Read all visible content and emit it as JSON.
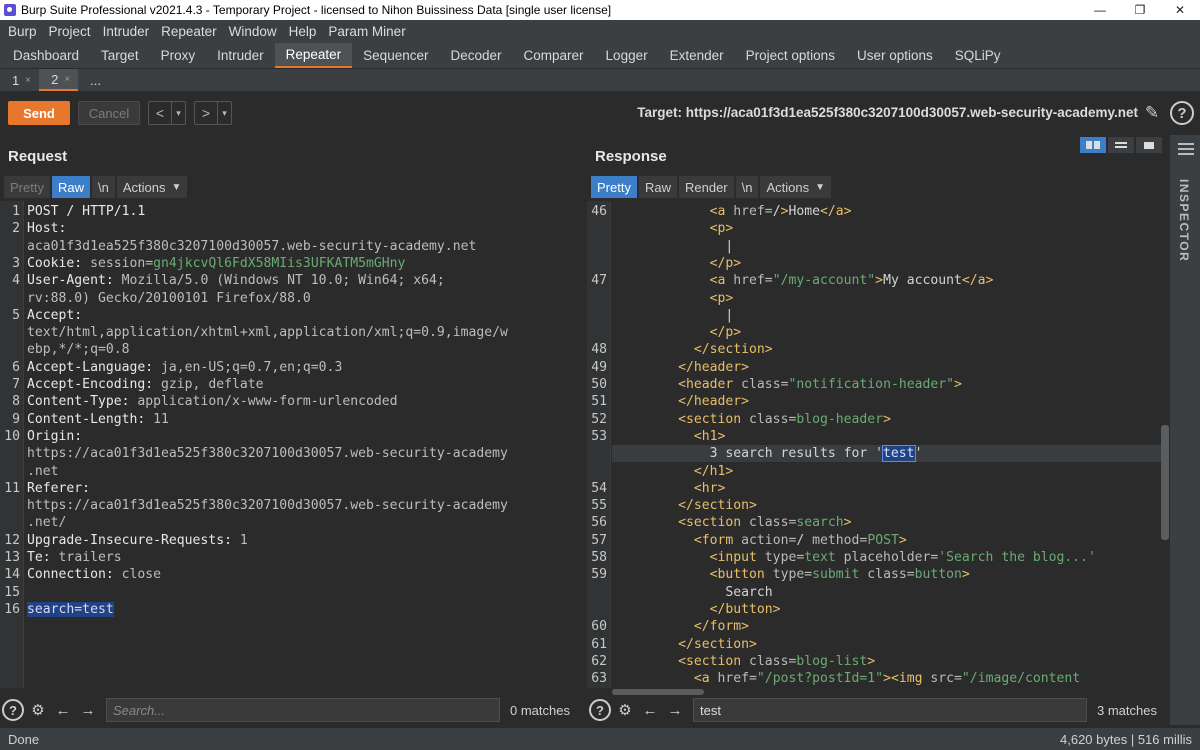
{
  "window": {
    "title": "Burp Suite Professional v2021.4.3 - Temporary Project - licensed to Nihon Buissiness Data [single user license]",
    "controls": [
      "—",
      "❐",
      "✕"
    ]
  },
  "menu": [
    "Burp",
    "Project",
    "Intruder",
    "Repeater",
    "Window",
    "Help",
    "Param Miner"
  ],
  "main_tabs": [
    "Dashboard",
    "Target",
    "Proxy",
    "Intruder",
    "Repeater",
    "Sequencer",
    "Decoder",
    "Comparer",
    "Logger",
    "Extender",
    "Project options",
    "User options",
    "SQLiPy"
  ],
  "active_main_tab": "Repeater",
  "sub_tabs": [
    {
      "label": "1",
      "close": "×"
    },
    {
      "label": "2",
      "close": "×"
    },
    {
      "label": "...",
      "close": ""
    }
  ],
  "toolbar": {
    "send": "Send",
    "cancel": "Cancel",
    "back": "<",
    "forward": ">",
    "dropdown": "▾",
    "target": "Target: https://aca01f3d1ea525f380c3207100d30057.web-security-academy.net"
  },
  "request": {
    "title": "Request",
    "tabs": [
      "Pretty",
      "Raw",
      "\\n",
      "Actions"
    ],
    "active_tab": "Raw",
    "search_placeholder": "Search...",
    "matches": "0 matches",
    "lines": [
      {
        "n": "1",
        "parts": [
          [
            "POST / HTTP/1.1",
            "key"
          ]
        ]
      },
      {
        "n": "2",
        "parts": [
          [
            "Host:",
            "key"
          ]
        ]
      },
      {
        "n": "",
        "parts": [
          [
            "aca01f3d1ea525f380c3207100d30057.web-security-academy.net",
            "val"
          ]
        ]
      },
      {
        "n": "3",
        "parts": [
          [
            "Cookie: ",
            "key"
          ],
          [
            "session=",
            "val"
          ],
          [
            "gn4jkcvQl6FdX58MIis3UFKATM5mGHny",
            "cookie"
          ]
        ]
      },
      {
        "n": "4",
        "parts": [
          [
            "User-Agent: ",
            "key"
          ],
          [
            "Mozilla/5.0 (Windows NT 10.0; Win64; x64;",
            "val"
          ]
        ]
      },
      {
        "n": "",
        "parts": [
          [
            "rv:88.0) Gecko/20100101 Firefox/88.0",
            "val"
          ]
        ]
      },
      {
        "n": "5",
        "parts": [
          [
            "Accept:",
            "key"
          ]
        ]
      },
      {
        "n": "",
        "parts": [
          [
            "text/html,application/xhtml+xml,application/xml;q=0.9,image/w",
            "val"
          ]
        ]
      },
      {
        "n": "",
        "parts": [
          [
            "ebp,*/*;q=0.8",
            "val"
          ]
        ]
      },
      {
        "n": "6",
        "parts": [
          [
            "Accept-Language: ",
            "key"
          ],
          [
            "ja,en-US;q=0.7,en;q=0.3",
            "val"
          ]
        ]
      },
      {
        "n": "7",
        "parts": [
          [
            "Accept-Encoding: ",
            "key"
          ],
          [
            "gzip, deflate",
            "val"
          ]
        ]
      },
      {
        "n": "8",
        "parts": [
          [
            "Content-Type: ",
            "key"
          ],
          [
            "application/x-www-form-urlencoded",
            "val"
          ]
        ]
      },
      {
        "n": "9",
        "parts": [
          [
            "Content-Length: ",
            "key"
          ],
          [
            "11",
            "val"
          ]
        ]
      },
      {
        "n": "10",
        "parts": [
          [
            "Origin:",
            "key"
          ]
        ]
      },
      {
        "n": "",
        "parts": [
          [
            "https://aca01f3d1ea525f380c3207100d30057.web-security-academy",
            "val"
          ]
        ]
      },
      {
        "n": "",
        "parts": [
          [
            ".net",
            "val"
          ]
        ]
      },
      {
        "n": "11",
        "parts": [
          [
            "Referer:",
            "key"
          ]
        ]
      },
      {
        "n": "",
        "parts": [
          [
            "https://aca01f3d1ea525f380c3207100d30057.web-security-academy",
            "val"
          ]
        ]
      },
      {
        "n": "",
        "parts": [
          [
            ".net/",
            "val"
          ]
        ]
      },
      {
        "n": "12",
        "parts": [
          [
            "Upgrade-Insecure-Requests: ",
            "key"
          ],
          [
            "1",
            "val"
          ]
        ]
      },
      {
        "n": "13",
        "parts": [
          [
            "Te: ",
            "key"
          ],
          [
            "trailers",
            "val"
          ]
        ]
      },
      {
        "n": "14",
        "parts": [
          [
            "Connection: ",
            "key"
          ],
          [
            "close",
            "val"
          ]
        ]
      },
      {
        "n": "15",
        "parts": []
      },
      {
        "n": "16",
        "parts": [
          [
            "search=test",
            "sel"
          ]
        ]
      }
    ]
  },
  "response": {
    "title": "Response",
    "tabs": [
      "Pretty",
      "Raw",
      "Render",
      "\\n",
      "Actions"
    ],
    "active_tab": "Pretty",
    "search_value": "test",
    "matches": "3 matches",
    "lines": [
      {
        "n": "46",
        "parts": [
          [
            "            ",
            "txt"
          ],
          [
            "<a ",
            "tag"
          ],
          [
            "href=",
            "attr"
          ],
          [
            "/",
            "txt"
          ],
          [
            ">",
            "tag"
          ],
          [
            "Home",
            "txt"
          ],
          [
            "</a>",
            "tag"
          ]
        ]
      },
      {
        "n": "",
        "parts": [
          [
            "            ",
            "txt"
          ],
          [
            "<p>",
            "tag"
          ]
        ]
      },
      {
        "n": "",
        "parts": [
          [
            "              |",
            "txt"
          ]
        ]
      },
      {
        "n": "",
        "parts": [
          [
            "            ",
            "txt"
          ],
          [
            "</p>",
            "tag"
          ]
        ]
      },
      {
        "n": "47",
        "parts": [
          [
            "            ",
            "txt"
          ],
          [
            "<a ",
            "tag"
          ],
          [
            "href=",
            "attr"
          ],
          [
            "\"/my-account\"",
            "str"
          ],
          [
            ">",
            "tag"
          ],
          [
            "My account",
            "txt"
          ],
          [
            "</a>",
            "tag"
          ]
        ]
      },
      {
        "n": "",
        "parts": [
          [
            "            ",
            "txt"
          ],
          [
            "<p>",
            "tag"
          ]
        ]
      },
      {
        "n": "",
        "parts": [
          [
            "              |",
            "txt"
          ]
        ]
      },
      {
        "n": "",
        "parts": [
          [
            "            ",
            "txt"
          ],
          [
            "</p>",
            "tag"
          ]
        ]
      },
      {
        "n": "48",
        "parts": [
          [
            "          ",
            "txt"
          ],
          [
            "</section>",
            "tag"
          ]
        ]
      },
      {
        "n": "49",
        "parts": [
          [
            "        ",
            "txt"
          ],
          [
            "</header>",
            "tag"
          ]
        ]
      },
      {
        "n": "50",
        "parts": [
          [
            "        ",
            "txt"
          ],
          [
            "<header ",
            "tag"
          ],
          [
            "class=",
            "attr"
          ],
          [
            "\"notification-header\"",
            "str"
          ],
          [
            ">",
            "tag"
          ]
        ]
      },
      {
        "n": "51",
        "parts": [
          [
            "        ",
            "txt"
          ],
          [
            "</header>",
            "tag"
          ]
        ]
      },
      {
        "n": "52",
        "parts": [
          [
            "        ",
            "txt"
          ],
          [
            "<section ",
            "tag"
          ],
          [
            "class=",
            "attr"
          ],
          [
            "blog-header",
            "str"
          ],
          [
            ">",
            "tag"
          ]
        ]
      },
      {
        "n": "53",
        "parts": [
          [
            "          ",
            "txt"
          ],
          [
            "<h1>",
            "tag"
          ]
        ]
      },
      {
        "n": "",
        "parts": [
          [
            "            3 search results for '",
            "txt"
          ],
          [
            "test",
            "box"
          ],
          [
            "'",
            "txt"
          ]
        ],
        "current": true
      },
      {
        "n": "",
        "parts": [
          [
            "          ",
            "txt"
          ],
          [
            "</h1>",
            "tag"
          ]
        ]
      },
      {
        "n": "54",
        "parts": [
          [
            "          ",
            "txt"
          ],
          [
            "<hr>",
            "tag"
          ]
        ]
      },
      {
        "n": "55",
        "parts": [
          [
            "        ",
            "txt"
          ],
          [
            "</section>",
            "tag"
          ]
        ]
      },
      {
        "n": "56",
        "parts": [
          [
            "        ",
            "txt"
          ],
          [
            "<section ",
            "tag"
          ],
          [
            "class=",
            "attr"
          ],
          [
            "search",
            "str"
          ],
          [
            ">",
            "tag"
          ]
        ]
      },
      {
        "n": "57",
        "parts": [
          [
            "          ",
            "txt"
          ],
          [
            "<form ",
            "tag"
          ],
          [
            "action=",
            "attr"
          ],
          [
            "/ ",
            "txt"
          ],
          [
            "method=",
            "attr"
          ],
          [
            "POST",
            "str"
          ],
          [
            ">",
            "tag"
          ]
        ]
      },
      {
        "n": "58",
        "parts": [
          [
            "            ",
            "txt"
          ],
          [
            "<input ",
            "tag"
          ],
          [
            "type=",
            "attr"
          ],
          [
            "text ",
            "str"
          ],
          [
            "placeholder=",
            "attr"
          ],
          [
            "'Search the blog...'",
            "str"
          ]
        ]
      },
      {
        "n": "59",
        "parts": [
          [
            "            ",
            "txt"
          ],
          [
            "<button ",
            "tag"
          ],
          [
            "type=",
            "attr"
          ],
          [
            "submit ",
            "str"
          ],
          [
            "class=",
            "attr"
          ],
          [
            "button",
            "str"
          ],
          [
            ">",
            "tag"
          ]
        ]
      },
      {
        "n": "",
        "parts": [
          [
            "              Search",
            "txt"
          ]
        ]
      },
      {
        "n": "",
        "parts": [
          [
            "            ",
            "txt"
          ],
          [
            "</button>",
            "tag"
          ]
        ]
      },
      {
        "n": "60",
        "parts": [
          [
            "          ",
            "txt"
          ],
          [
            "</form>",
            "tag"
          ]
        ]
      },
      {
        "n": "61",
        "parts": [
          [
            "        ",
            "txt"
          ],
          [
            "</section>",
            "tag"
          ]
        ]
      },
      {
        "n": "62",
        "parts": [
          [
            "        ",
            "txt"
          ],
          [
            "<section ",
            "tag"
          ],
          [
            "class=",
            "attr"
          ],
          [
            "blog-list",
            "str"
          ],
          [
            ">",
            "tag"
          ]
        ]
      },
      {
        "n": "63",
        "parts": [
          [
            "          ",
            "txt"
          ],
          [
            "<a ",
            "tag"
          ],
          [
            "href=",
            "attr"
          ],
          [
            "\"/post?postId=1\"",
            "str"
          ],
          [
            ">",
            "tag"
          ],
          [
            "<img ",
            "tag"
          ],
          [
            "src=",
            "attr"
          ],
          [
            "\"/image/content",
            "str"
          ]
        ]
      }
    ]
  },
  "inspector": {
    "label": "INSPECTOR"
  },
  "status": {
    "left": "Done",
    "right": "4,620 bytes | 516 millis"
  },
  "icons": {
    "gear": "gear-icon",
    "help": "help-icon",
    "arrow_left": "arrow-left-icon",
    "arrow_right": "arrow-right-icon",
    "pencil": "pencil-icon"
  }
}
